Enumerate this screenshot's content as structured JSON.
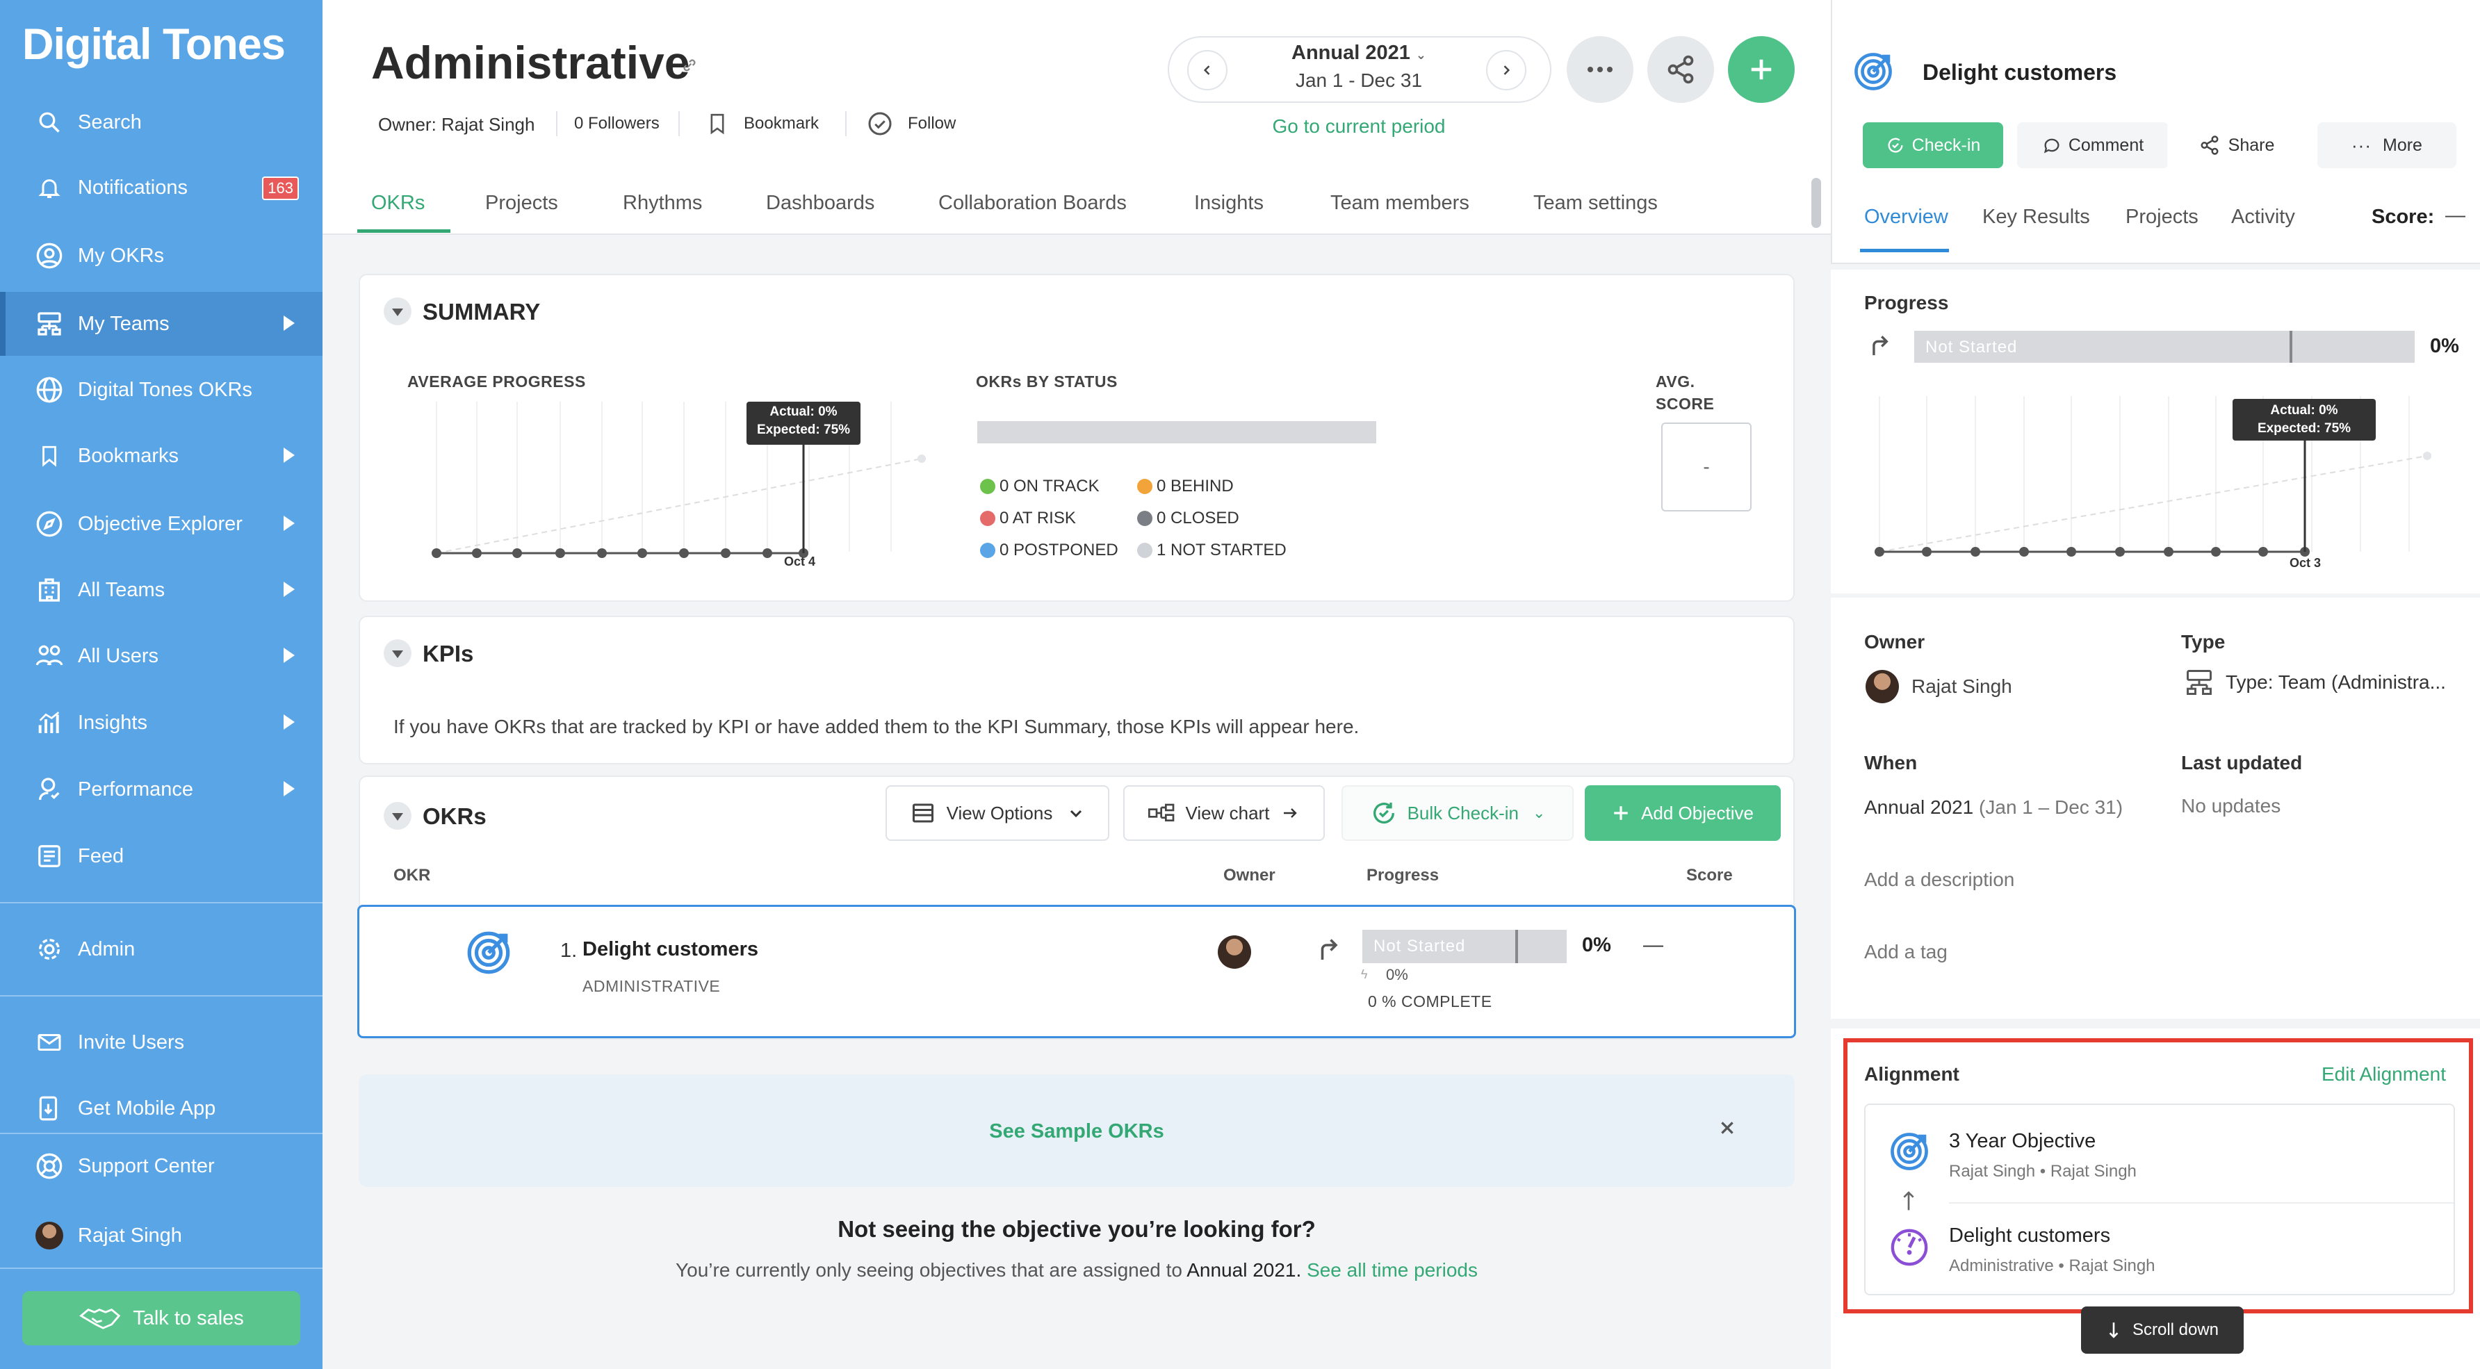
{
  "sidebar": {
    "brand": "Digital Tones",
    "items": [
      {
        "label": "Search"
      },
      {
        "label": "Notifications",
        "badge": "163"
      },
      {
        "label": "My OKRs"
      },
      {
        "label": "My Teams"
      },
      {
        "label": "Digital Tones OKRs"
      },
      {
        "label": "Bookmarks"
      },
      {
        "label": "Objective Explorer"
      },
      {
        "label": "All Teams"
      },
      {
        "label": "All Users"
      },
      {
        "label": "Insights"
      },
      {
        "label": "Performance"
      },
      {
        "label": "Feed"
      },
      {
        "label": "Admin"
      },
      {
        "label": "Invite Users"
      },
      {
        "label": "Get Mobile App"
      },
      {
        "label": "Support Center"
      },
      {
        "label": "Rajat Singh"
      }
    ],
    "sales_button": "Talk to sales"
  },
  "header": {
    "title": "Administrative",
    "owner": "Owner: Rajat Singh",
    "followers": "0 Followers",
    "bookmark": "Bookmark",
    "follow": "Follow",
    "period_label": "Annual 2021",
    "period_range": "Jan 1 - Dec 31",
    "current_period_link": "Go to current period",
    "tabs": [
      "OKRs",
      "Projects",
      "Rhythms",
      "Dashboards",
      "Collaboration Boards",
      "Insights",
      "Team members",
      "Team settings"
    ]
  },
  "summary": {
    "title": "SUMMARY",
    "avg_progress_label": "AVERAGE PROGRESS",
    "tooltip_actual": "Actual: 0%",
    "tooltip_expected": "Expected: 75%",
    "date_marker": "Oct 4",
    "status_label": "OKRs BY STATUS",
    "status": [
      {
        "label": "0 ON TRACK",
        "color": "#6cc24a"
      },
      {
        "label": "0 BEHIND",
        "color": "#f2a43a"
      },
      {
        "label": "0 AT RISK",
        "color": "#e56a6a"
      },
      {
        "label": "0 CLOSED",
        "color": "#7b7f85"
      },
      {
        "label": "0 POSTPONED",
        "color": "#5aa5e6"
      },
      {
        "label": "1 NOT STARTED",
        "color": "#cfd2d6"
      }
    ],
    "avg_score_label_1": "AVG.",
    "avg_score_label_2": "SCORE",
    "avg_score_value": "-"
  },
  "kpis": {
    "title": "KPIs",
    "message": "If you have OKRs that are tracked by KPI or have added them to the KPI Summary, those KPIs will appear here."
  },
  "okrs": {
    "title": "OKRs",
    "view_options": "View Options",
    "view_chart": "View chart",
    "bulk_checkin": "Bulk Check-in",
    "add_objective": "Add Objective",
    "columns": {
      "okr": "OKR",
      "owner": "Owner",
      "progress": "Progress",
      "score": "Score"
    },
    "rows": [
      {
        "number": "1.",
        "name": "Delight customers",
        "team": "ADMINISTRATIVE",
        "status": "Not Started",
        "progress_pct": "0%",
        "progress_sub": "0%",
        "complete": "0 % COMPLETE",
        "score": "—",
        "progress_fraction": 0.0
      }
    ],
    "see_sample": "See Sample OKRs",
    "not_seeing_title": "Not seeing the objective you’re looking for?",
    "not_seeing_text_1": "You’re currently only seeing objectives that are assigned to ",
    "not_seeing_period": "Annual 2021.",
    "not_seeing_link": "See all time periods"
  },
  "detail": {
    "title": "Delight customers",
    "checkin": "Check-in",
    "comment": "Comment",
    "share": "Share",
    "more": "More",
    "tabs": [
      "Overview",
      "Key Results",
      "Projects",
      "Activity"
    ],
    "score_label": "Score:",
    "score_value": "—",
    "progress_label": "Progress",
    "progress_status": "Not Started",
    "progress_pct": "0%",
    "tooltip_actual": "Actual: 0%",
    "tooltip_expected": "Expected: 75%",
    "date_marker": "Oct 3",
    "owner_label": "Owner",
    "owner_value": "Rajat Singh",
    "type_label": "Type",
    "type_value": "Type: Team (Administra...",
    "when_label": "When",
    "when_value": "Annual 2021",
    "when_range": "(Jan 1 – Dec 31)",
    "last_updated_label": "Last updated",
    "last_updated_value": "No updates",
    "add_description": "Add a description",
    "add_tag": "Add a tag",
    "alignment_label": "Alignment",
    "edit_alignment": "Edit Alignment",
    "alignment": [
      {
        "name": "3 Year Objective",
        "sub": "Rajat Singh • Rajat Singh"
      },
      {
        "name": "Delight customers",
        "sub": "Administrative • Rajat Singh"
      }
    ],
    "scroll_down": "Scroll down"
  },
  "colors": {
    "sidebar": "#5aa5e6",
    "accent_green": "#34a874",
    "accent_blue": "#2f8ad8",
    "highlight_red": "#e53a2f"
  }
}
